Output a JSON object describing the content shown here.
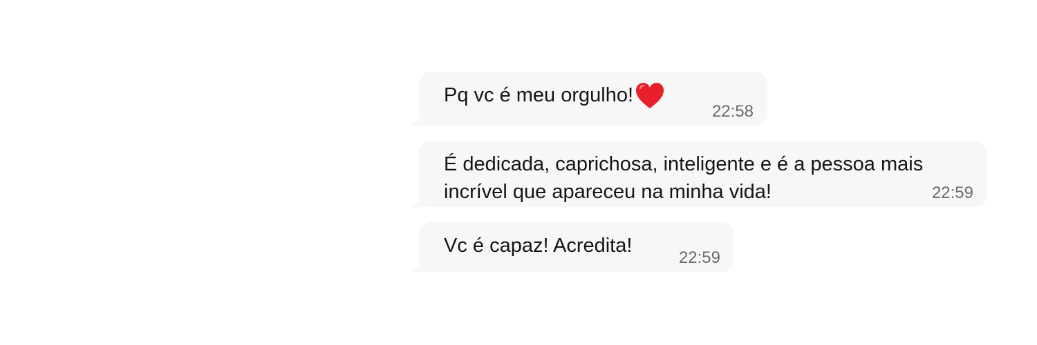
{
  "messages": [
    {
      "text": "Pq vc é meu orgulho!",
      "emoji": "red-heart-icon",
      "time": "22:58"
    },
    {
      "text": "É dedicada, caprichosa, inteligente e é a pessoa mais\nincrível que apareceu na minha vida!",
      "time": "22:59"
    },
    {
      "text": "Vc é capaz! Acredita!",
      "time": "22:59"
    }
  ],
  "colors": {
    "bubble_background": "#f7f7f7",
    "text": "#151515",
    "timestamp": "#6a6a6a",
    "heart": "#e8202a"
  }
}
